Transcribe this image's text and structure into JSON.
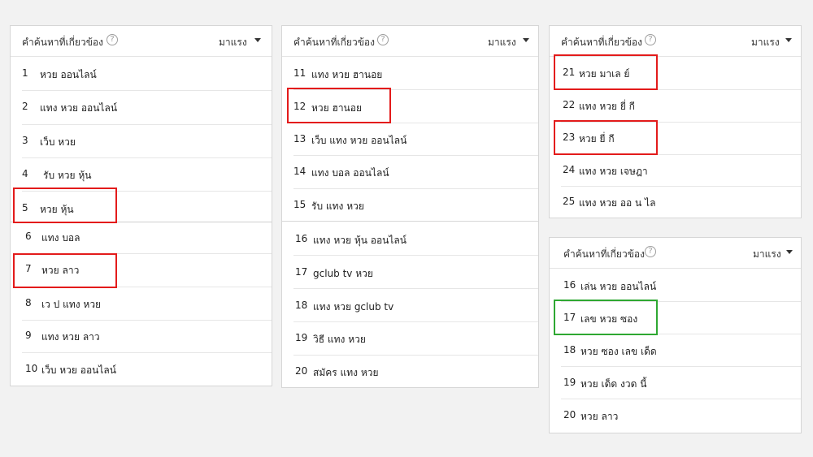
{
  "colors": {
    "background": "#f2f2f2",
    "panel": "#ffffff",
    "highlight_red": "#e31b1b",
    "highlight_green": "#2ea832"
  },
  "icons": {
    "help": "help-circle-icon",
    "dropdown": "triangle-down-icon"
  },
  "panels": [
    {
      "title": "คำค้นหาที่เกี่ยวข้อง",
      "help_glyph": "?",
      "sort_label": "มาแรง",
      "items": [
        {
          "rank": "1",
          "term": "หวย ออนไลน์"
        },
        {
          "rank": "2",
          "term": "แทง หวย ออนไลน์"
        },
        {
          "rank": "3",
          "term": "เว็บ หวย"
        },
        {
          "rank": "4",
          "term": "รับ หวย หุ้น"
        },
        {
          "rank": "5",
          "term": "หวย หุ้น"
        },
        {
          "rank": "6",
          "term": "แทง บอล"
        },
        {
          "rank": "7",
          "term": "หวย ลาว"
        },
        {
          "rank": "8",
          "term": "เว ป แทง หวย"
        },
        {
          "rank": "9",
          "term": "แทง หวย ลาว"
        },
        {
          "rank": "10",
          "term": "เว็บ หวย ออนไลน์"
        }
      ]
    },
    {
      "title": "คำค้นหาที่เกี่ยวข้อง",
      "help_glyph": "?",
      "sort_label": "มาแรง",
      "items": [
        {
          "rank": "11",
          "term": "แทง หวย ฮานอย"
        },
        {
          "rank": "12",
          "term": "หวย ฮานอย"
        },
        {
          "rank": "13",
          "term": "เว็บ แทง หวย ออนไลน์"
        },
        {
          "rank": "14",
          "term": "แทง บอล ออนไลน์"
        },
        {
          "rank": "15",
          "term": "รับ แทง หวย"
        },
        {
          "rank": "16",
          "term": "แทง หวย หุ้น ออนไลน์"
        },
        {
          "rank": "17",
          "term": "gclub tv หวย"
        },
        {
          "rank": "18",
          "term": "แทง หวย gclub tv"
        },
        {
          "rank": "19",
          "term": "วิธี แทง หวย"
        },
        {
          "rank": "20",
          "term": "สมัคร แทง หวย"
        }
      ]
    },
    {
      "title": "คำค้นหาที่เกี่ยวข้อง",
      "help_glyph": "?",
      "sort_label": "มาแรง",
      "items": [
        {
          "rank": "21",
          "term": "หวย มาเล ย์"
        },
        {
          "rank": "22",
          "term": "แทง หวย ยี่ กี"
        },
        {
          "rank": "23",
          "term": "หวย ยี่ กี"
        },
        {
          "rank": "24",
          "term": "แทง หวย เจษฎา"
        },
        {
          "rank": "25",
          "term": "แทง หวย ออ น ไล"
        }
      ]
    },
    {
      "title": "คำค้นหาที่เกี่ยวข้อง",
      "help_glyph": "?",
      "sort_label": "มาแรง",
      "items": [
        {
          "rank": "16",
          "term": "เล่น หวย ออนไลน์"
        },
        {
          "rank": "17",
          "term": "เลข หวย ซอง"
        },
        {
          "rank": "18",
          "term": "หวย ซอง เลข เด็ด"
        },
        {
          "rank": "19",
          "term": "หวย เด็ด งวด นี้"
        },
        {
          "rank": "20",
          "term": "หวย ลาว"
        }
      ]
    }
  ]
}
